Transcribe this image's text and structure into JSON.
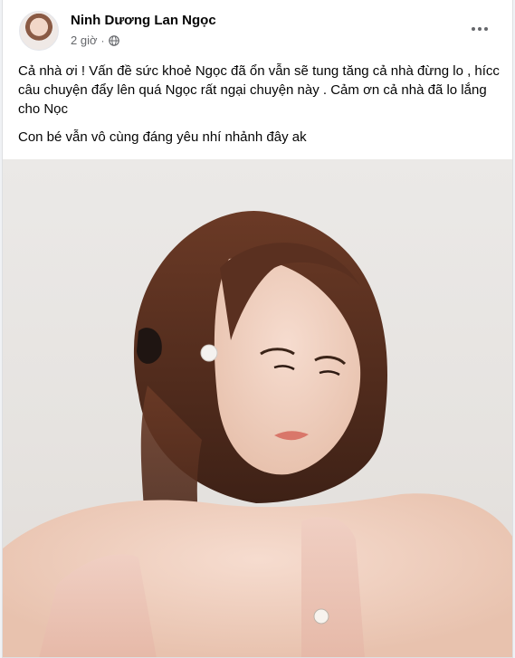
{
  "post": {
    "author": "Ninh Dương Lan Ngọc",
    "time": "2 giờ",
    "separator": "·",
    "privacy_icon": "globe-icon",
    "more_icon": "more-options-icon",
    "paragraphs": [
      "Cả nhà ơi ! Vấn đề sức khoẻ Ngọc đã ổn vẫn sẽ tung tăng cả nhà đừng lo , hícc câu chuyện đẩy lên quá Ngọc rất ngại chuyện này . Cảm ơn cả nhà đã lo lắng cho Nọc",
      "Con bé vẫn vô cùng đáng yêu nhí nhảnh đây ak"
    ]
  },
  "colors": {
    "text_primary": "#050505",
    "text_secondary": "#65676b",
    "card_background": "#ffffff",
    "page_background": "#f0f2f5"
  }
}
